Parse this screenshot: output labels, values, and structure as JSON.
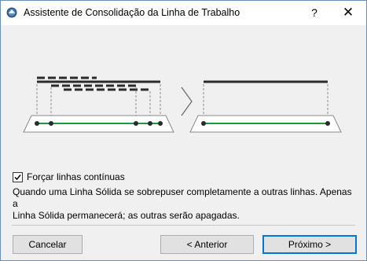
{
  "window": {
    "title": "Assistente de Consolidação da Linha de Trabalho",
    "help_label": "?",
    "close_label": "✕"
  },
  "option": {
    "label": "Forçar linhas contínuas",
    "checked": true
  },
  "description": {
    "line1": "Quando uma Linha Sólida se sobrepuser completamente a outras linhas. Apenas a",
    "line2": "Linha Sólida permanecerá; as outras serão apagadas."
  },
  "buttons": {
    "cancel": "Cancelar",
    "back": "< Anterior",
    "next": "Próximo >"
  },
  "colors": {
    "accent": "#0078d7",
    "line_green": "#1a9a3a",
    "line_dark": "#2b2b2b"
  }
}
